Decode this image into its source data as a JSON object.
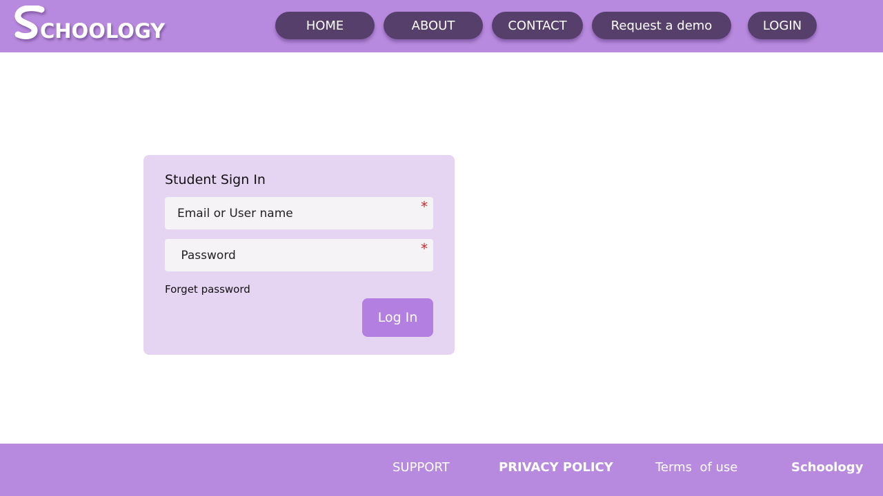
{
  "header": {
    "logo_text": "CHOOLOGY",
    "nav": [
      {
        "label": "HOME"
      },
      {
        "label": "ABOUT"
      },
      {
        "label": "CONTACT"
      },
      {
        "label": "Request a demo"
      },
      {
        "label": "LOGIN"
      }
    ]
  },
  "signin": {
    "title": "Student Sign In",
    "email_placeholder": "Email or User name",
    "password_placeholder": " Password",
    "required_marker": "*",
    "forgot_label": "Forget password",
    "login_label": "Log In"
  },
  "footer": {
    "support": "SUPPORT",
    "privacy": "PRIVACY POLICY",
    "terms": "Terms  of use",
    "brand": "Schoology"
  },
  "colors": {
    "header_bg": "#b88adf",
    "nav_button_bg": "#56406b",
    "card_bg": "#e5d5f2",
    "login_button_bg": "#b37fe0",
    "required_marker": "#cc2b2b"
  }
}
